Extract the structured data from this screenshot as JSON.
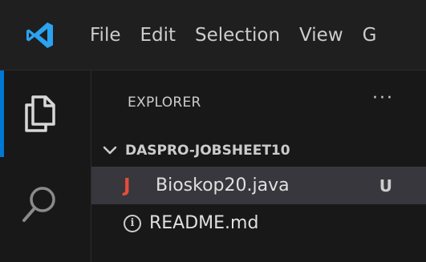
{
  "titlebar": {
    "menu": [
      "File",
      "Edit",
      "Selection",
      "View",
      "G"
    ]
  },
  "activitybar": {
    "items": [
      {
        "icon": "explorer-files-icon",
        "active": true
      },
      {
        "icon": "search-icon",
        "active": false
      }
    ],
    "accent": "#0078d4"
  },
  "sidebar": {
    "title": "EXPLORER",
    "more_actions": "···",
    "section": {
      "name": "DASPRO-JOBSHEET10",
      "files": [
        {
          "icon": "java-file-icon",
          "icon_text": "J",
          "name": "Bioskop20.java",
          "badge": "U",
          "selected": true
        },
        {
          "icon": "info-icon",
          "icon_text": "i",
          "name": "README.md",
          "badge": "",
          "selected": false
        }
      ]
    }
  },
  "colors": {
    "background": "#181818",
    "selected_row": "#37373d",
    "java_icon": "#e44d3a",
    "logo": "#2aa3f0"
  }
}
